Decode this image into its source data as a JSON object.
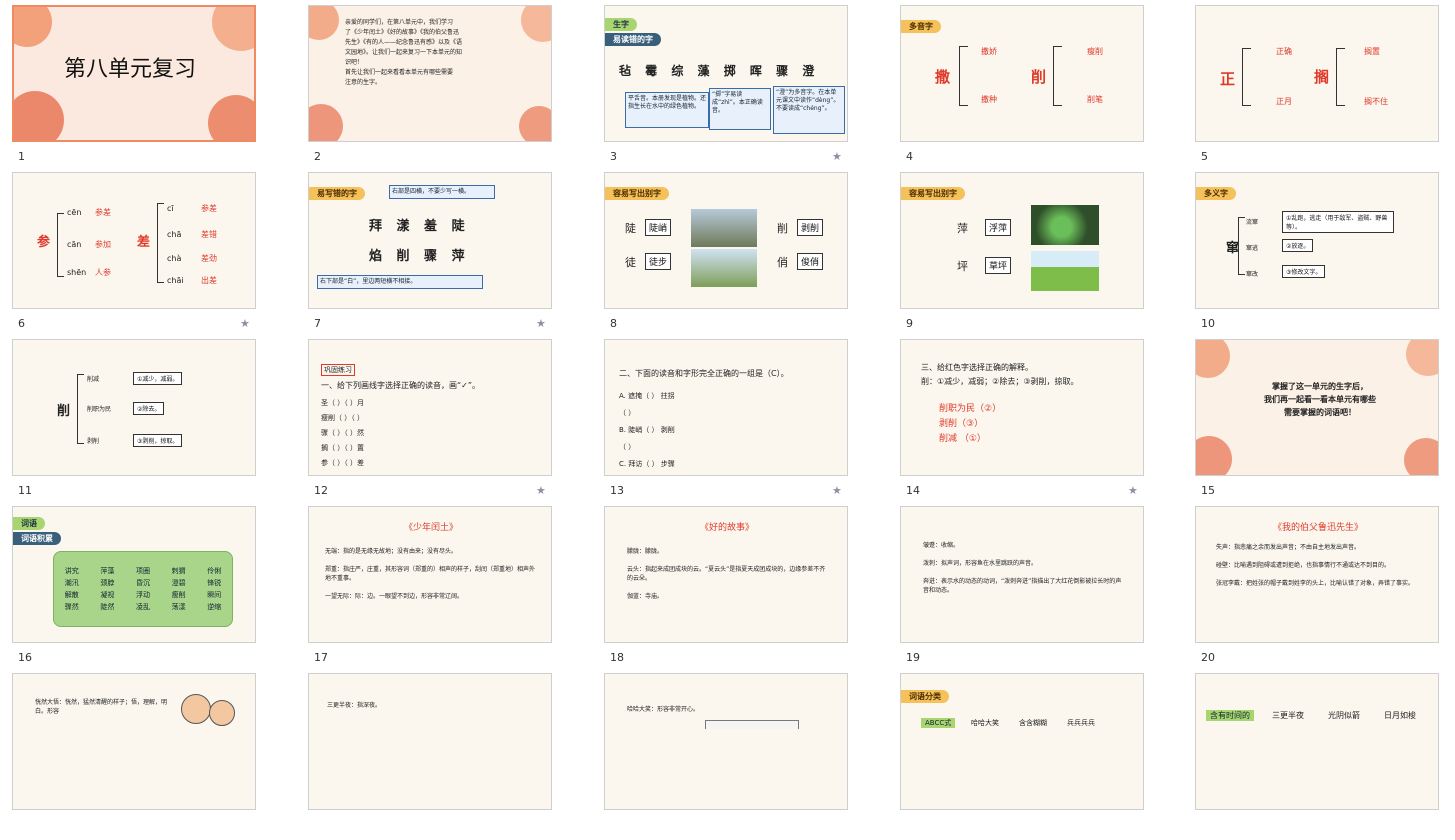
{
  "thumbnails": [
    {
      "n": "1",
      "title": "第八单元复习"
    },
    {
      "n": "2",
      "lines": [
        "亲爱的同学们，在第八单元中，我们学习",
        "了《少年闰土》《好的故事》《我的伯父鲁迅",
        "先生》《有的人——纪念鲁迅有感》以及《语",
        "文园地》。让我们一起来复习一下本单元的知",
        "识吧！",
        "首先让我们一起来看看本单元有哪些需要",
        "注意的生字。"
      ]
    },
    {
      "n": "3",
      "section": "生字",
      "tag": "易读错的字",
      "chars": "毡 霉 综 藻 掷 晖 骤 澄",
      "callouts": [
        "平舌音。本册发现是植物。还指生长在水中的绿色植物。",
        "“掷”字易读成“zhì”。本正确读音。",
        "“澄”为多音字。在本单元课文中读作“dèng”。不要读成“chéng”。"
      ]
    },
    {
      "n": "4",
      "tag": "多音字",
      "char_a": "撒",
      "a_items": [
        "撒娇",
        "撒种"
      ],
      "char_b": "削",
      "b_items": [
        "瘦削",
        "削笔"
      ]
    },
    {
      "n": "5",
      "char_a": "正",
      "a_items": [
        "正确",
        "正月"
      ],
      "char_b": "搁",
      "b_items": [
        "搁置",
        "搁不住"
      ]
    },
    {
      "n": "6",
      "char_a": "参",
      "a_py": [
        "cēn",
        "cān",
        "shēn"
      ],
      "a_items": [
        "参差",
        "参加",
        "人参"
      ],
      "char_b": "差",
      "b_py": [
        "cī",
        "chā",
        "chà",
        "chāi"
      ],
      "b_items": [
        "参差",
        "差错",
        "差劲",
        "出差"
      ]
    },
    {
      "n": "7",
      "tag": "易写错的字",
      "note_top": "右部是四横，不要少写一横。",
      "row1": "拜 漾 羞 陡",
      "row2": "焰 削 骤 萍",
      "note_bottom": "右下部是“白”，里边两短横不相接。"
    },
    {
      "n": "8",
      "tag": "容易写出别字",
      "c1": "陡",
      "w1": "陡峭",
      "c2": "徒",
      "w2": "徒步",
      "c3": "削",
      "w3": "剥削",
      "c4": "俏",
      "w4": "俊俏"
    },
    {
      "n": "9",
      "tag": "容易写出别字",
      "c1": "萍",
      "w1": "浮萍",
      "c2": "坪",
      "w2": "草坪"
    },
    {
      "n": "10",
      "tag": "多义字",
      "char": "窜",
      "items": [
        "流窜",
        "窜逃",
        "窜改"
      ],
      "defs": [
        "①乱跑，逃走（用于敌军、盗贼、野兽等）。",
        "②放逐。",
        "③修改文字。"
      ]
    },
    {
      "n": "11",
      "char": "削",
      "items": [
        "削减",
        "削职为民",
        "剥削"
      ],
      "defs": [
        "①减少，减弱。",
        "②除去。",
        "③剥削，掠取。"
      ]
    },
    {
      "n": "12",
      "label": "巩固练习",
      "question": "一、给下列画线字选择正确的读音，画“✓”。",
      "rows": [
        "圣（ ）（ ）月",
        "瘦削（ ）（ ）",
        "骤（ ）（ ）然",
        "搁（ ）（ ）置",
        "参（ ）（ ）差"
      ]
    },
    {
      "n": "13",
      "question": "二、下面的读音和字形完全正确的一组是（C）。",
      "rows": [
        "A. 遮掩（ ） 拄拐",
        "（ ）",
        "B. 陡峭（ ） 剥削",
        "（ ）",
        "C. 拜访（ ） 步骤"
      ]
    },
    {
      "n": "14",
      "question": "三、给红色字选择正确的解释。",
      "prompt": "削：①减少，减弱；②除去；③剥削，掠取。",
      "rows": [
        "削职为民（②）",
        "剥削（③）",
        "削减 （①）"
      ]
    },
    {
      "n": "15",
      "lines": [
        "掌握了这一单元的生字后，",
        "我们再一起看一看本单元有哪些",
        "需要掌握的词语吧！"
      ]
    },
    {
      "n": "16",
      "section": "词语",
      "tag": "词语积累",
      "words": [
        "讲究",
        "萍藻",
        "项圈",
        "刺猬",
        "伶俐",
        "潮汛",
        "颈脖",
        "昏沉",
        "澄碧",
        "锋锐",
        "解散",
        "凝视",
        "浮动",
        "瘦削",
        "瞬间",
        "骤然",
        "陡然",
        "凌乱",
        "荡漾",
        "逆缩"
      ]
    },
    {
      "n": "17",
      "title": "《少年闰土》",
      "entries": [
        "无端：指的是无缘无故地；没有由来；没有尽头。",
        "郑重：指庄严，庄重，其形容词（郑重的）相声的样子，刮闰（郑重地）相声外地不重事。",
        "一望无际：际：边。一眼望不到边，形容非常辽阔。"
      ]
    },
    {
      "n": "18",
      "title": "《好的故事》",
      "entries": [
        "朦胧：朦胧。",
        "云头：指起来成团成块的云。“夏云头”是指夏天成团成块的，边缘参差不齐的云朵。",
        "伽蓝：寺庙。"
      ]
    },
    {
      "n": "19",
      "entries": [
        "皱蹙：收缩。",
        "泼刺：拟声词，形容鱼在水里跳跃的声音。",
        "奔迸：表示水的动态的动词，“泼刺奔迸”指描出了大红花倒影被拉长时的声音和动态。"
      ]
    },
    {
      "n": "20",
      "title": "《我的伯父鲁迅先生》",
      "entries": [
        "失声：指悲痛之余而发出声音；不由自主地发出声音。",
        "碰壁：比喻遇到阻碍或遭到拒绝，也指事情行不通或达不到目的。",
        "张冠李戴：把姓张的帽子戴到姓李的头上，比喻认错了对象，弄错了事实。"
      ]
    },
    {
      "n": "21",
      "entries": [
        "恍然大悟：恍然，猛然清醒的样子；悟，理解，明白。形容"
      ]
    },
    {
      "n": "22",
      "entries": [
        "三更半夜：指深夜。"
      ]
    },
    {
      "n": "23",
      "entries": [
        "哈哈大笑：形容非常开心。"
      ]
    },
    {
      "n": "24",
      "tag": "词语分类",
      "entries": [
        "ABCC式",
        "哈哈大笑",
        "含含糊糊",
        "兵兵兵兵"
      ]
    },
    {
      "n": "25",
      "label": "含有时间的",
      "entries": [
        "三更半夜",
        "光阴似箭",
        "日月如梭"
      ]
    }
  ],
  "colors": {
    "selection": "#f08a63",
    "red": "#e03b2a",
    "blue": "#2457c9",
    "tag": "#f5c15a",
    "green": "#a7d56f"
  }
}
